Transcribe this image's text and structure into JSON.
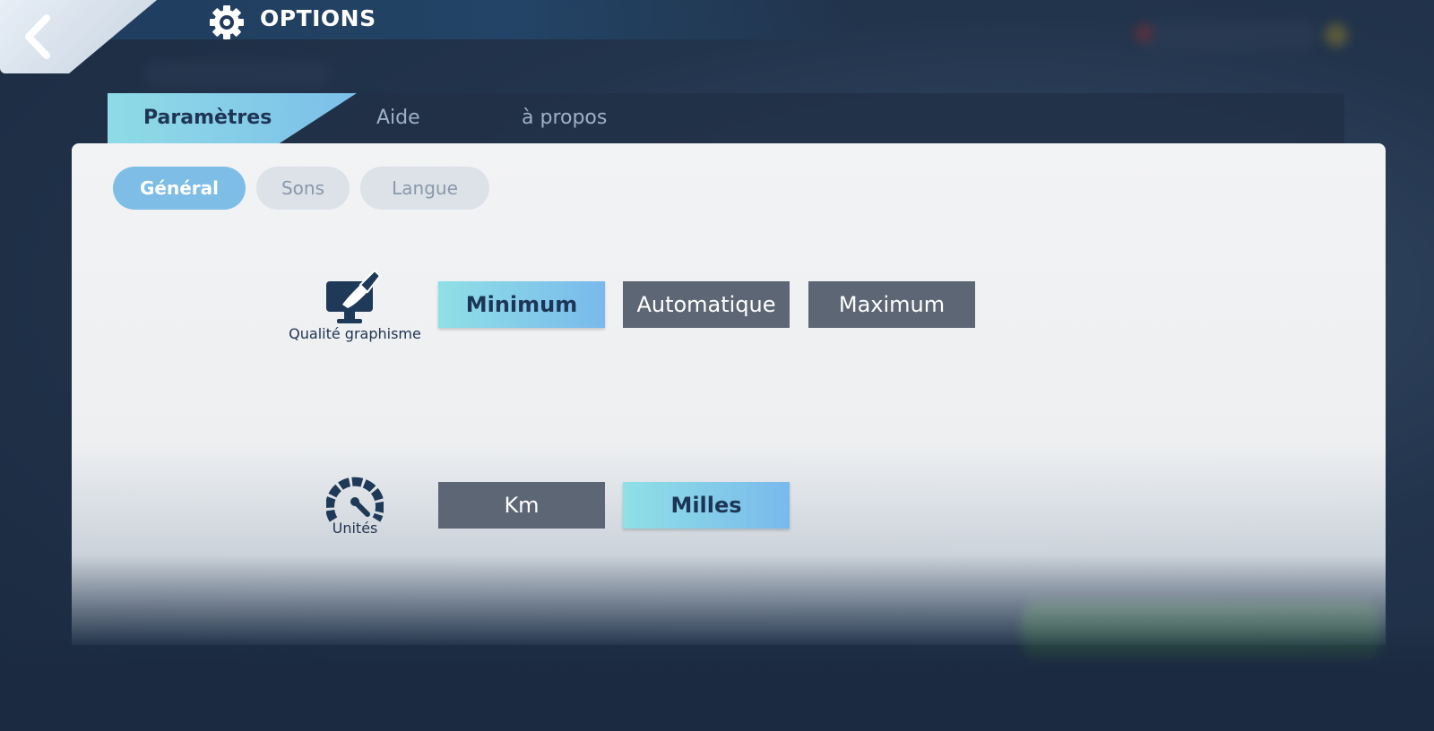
{
  "header": {
    "title": "OPTIONS",
    "back_icon": "chevron-left-icon",
    "title_icon": "gear-icon"
  },
  "tabs": [
    {
      "label": "Paramètres",
      "active": true
    },
    {
      "label": "Aide",
      "active": false
    },
    {
      "label": "à propos",
      "active": false
    }
  ],
  "subtabs": [
    {
      "label": "Général",
      "active": true
    },
    {
      "label": "Sons",
      "active": false
    },
    {
      "label": "Langue",
      "active": false
    }
  ],
  "settings": {
    "graphics": {
      "label": "Qualité graphisme",
      "icon": "monitor-brush-icon",
      "options": [
        "Minimum",
        "Automatique",
        "Maximum"
      ],
      "selected": "Minimum"
    },
    "units": {
      "label": "Unités",
      "icon": "speedometer-icon",
      "options": [
        "Km",
        "Milles"
      ],
      "selected": "Milles"
    }
  },
  "colors": {
    "accent_start": "#8fe0e6",
    "accent_end": "#79b9ec",
    "option_off": "#5d6674",
    "text_dark": "#1f3350"
  }
}
